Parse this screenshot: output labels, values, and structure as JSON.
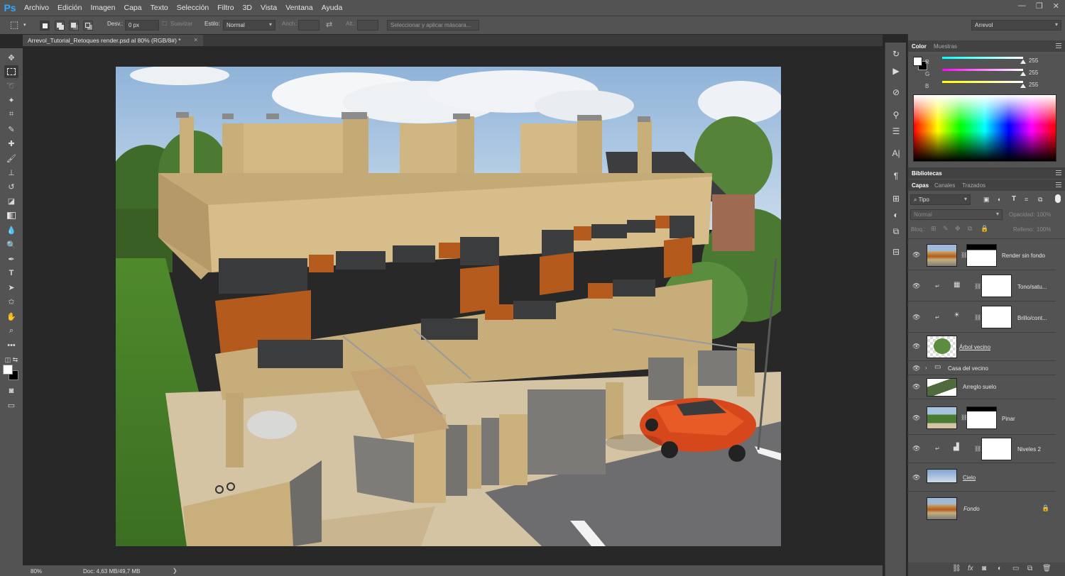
{
  "app": {
    "logo": "Ps"
  },
  "menu": [
    "Archivo",
    "Edición",
    "Imagen",
    "Capa",
    "Texto",
    "Selección",
    "Filtro",
    "3D",
    "Vista",
    "Ventana",
    "Ayuda"
  ],
  "window_controls": {
    "minimize": "—",
    "restore": "❐",
    "close": "✕"
  },
  "options": {
    "feather_label": "Desv.:",
    "feather_value": "0 px",
    "antialias_label": "Suavizar",
    "style_label": "Estilo:",
    "style_value": "Normal",
    "width_label": "Anch.:",
    "height_label": "Alt.:",
    "select_mask_button": "Seleccionar y aplicar máscara...",
    "workspace_value": "Arrevol"
  },
  "document": {
    "tab_title": "Arrevol_Tutorial_Retoques render.psd al 80% (RGB/8#) *",
    "close": "×"
  },
  "status": {
    "zoom": "80%",
    "doc_size": "Doc: 4,63 MB/49,7 MB",
    "arrow": "❯"
  },
  "color_panel": {
    "tabs": [
      "Color",
      "Muestras"
    ],
    "r_label": "R",
    "r_value": "255",
    "g_label": "G",
    "g_value": "255",
    "b_label": "B",
    "b_value": "255"
  },
  "libraries_panel": {
    "title": "Bibliotecas"
  },
  "layers_panel": {
    "tabs": [
      "Capas",
      "Canales",
      "Trazados"
    ],
    "filter_kind": "Tipo",
    "blend_mode": "Normal",
    "opacity_label": "Opacidad:",
    "opacity_value": "100%",
    "lock_label": "Bloq.:",
    "fill_label": "Relleno:",
    "fill_value": "100%",
    "layers": [
      {
        "name": "Render sin fondo"
      },
      {
        "name": "Tono/satu..."
      },
      {
        "name": "Brillo/cont..."
      },
      {
        "name": "Árbol vecino"
      },
      {
        "name": "Casa del vecino"
      },
      {
        "name": "Arreglo suelo"
      },
      {
        "name": "Pinar"
      },
      {
        "name": "Niveles 2"
      },
      {
        "name": "Cielo"
      },
      {
        "name": "Fondo"
      }
    ]
  },
  "colors": {
    "ui_dark": "#282828",
    "ui_panel": "#535353",
    "accent": "#31a8ff"
  }
}
